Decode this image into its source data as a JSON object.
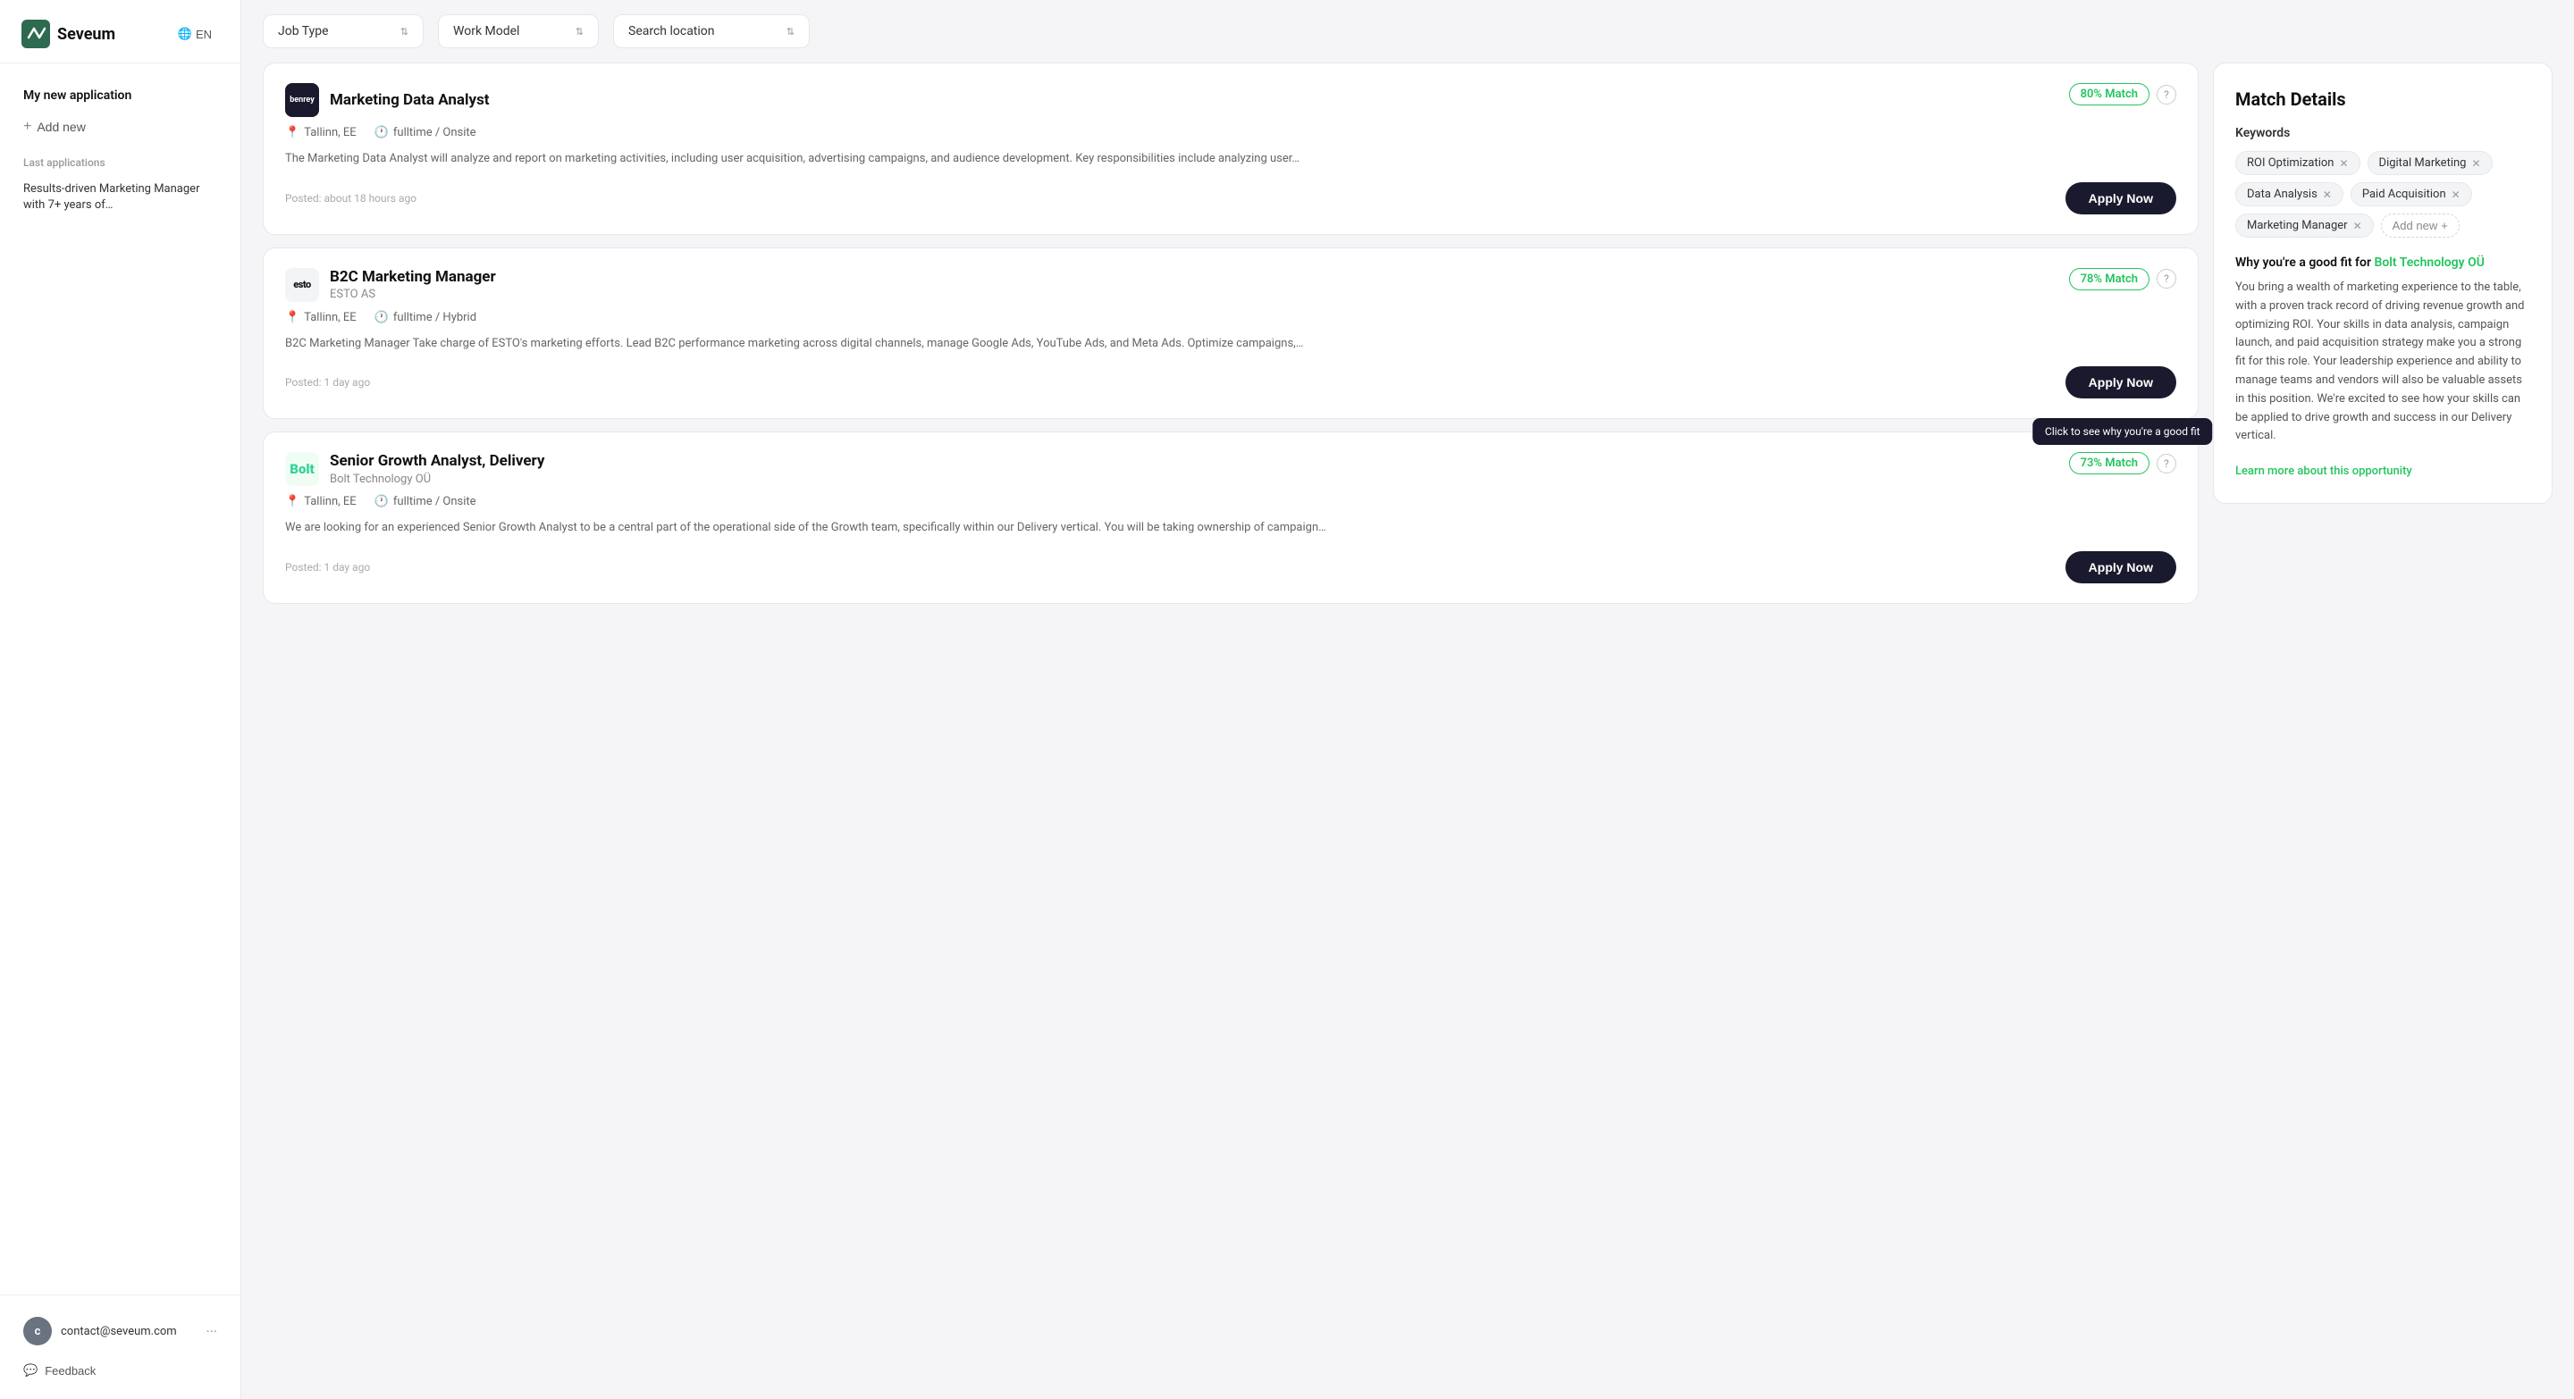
{
  "sidebar": {
    "logo_text": "Seveum",
    "lang": "EN",
    "app_title": "My new application",
    "add_new_label": "Add new",
    "last_applications_label": "Last applications",
    "last_app_preview": "Results-driven Marketing Manager with 7+ years of…",
    "user_email": "contact@seveum.com",
    "user_initial": "c",
    "feedback_label": "Feedback"
  },
  "filters": {
    "job_type_label": "Job Type",
    "work_model_label": "Work Model",
    "search_location_placeholder": "Search location"
  },
  "jobs": [
    {
      "id": "job1",
      "company": "Benrey",
      "logo_type": "benrey",
      "title": "Marketing Data Analyst",
      "location": "Tallinn, EE",
      "job_type": "fulltime / Onsite",
      "match": "80% Match",
      "description": "The Marketing Data Analyst will analyze and report on marketing activities, including user acquisition, advertising campaigns, and audience development. Key responsibilities include analyzing user…",
      "posted": "Posted: about 18 hours ago",
      "apply_label": "Apply Now"
    },
    {
      "id": "job2",
      "company": "ESTO AS",
      "logo_type": "esto",
      "title": "B2C Marketing Manager",
      "location": "Tallinn, EE",
      "job_type": "fulltime / Hybrid",
      "match": "78% Match",
      "description": "B2C Marketing Manager Take charge of ESTO's marketing efforts. Lead B2C performance marketing across digital channels, manage Google Ads, YouTube Ads, and Meta Ads. Optimize campaigns,…",
      "posted": "Posted: 1 day ago",
      "apply_label": "Apply Now"
    },
    {
      "id": "job3",
      "company": "Bolt Technology OÜ",
      "logo_type": "bolt",
      "title": "Senior Growth Analyst, Delivery",
      "location": "Tallinn, EE",
      "job_type": "fulltime / Onsite",
      "match": "73% Match",
      "description": "We are looking for an experienced Senior Growth Analyst to be a central part of the operational side of the Growth team, specifically within our Delivery vertical. You will be taking ownership of campaign…",
      "posted": "Posted: 1 day ago",
      "apply_label": "Apply Now",
      "tooltip": "Click to see why you're a good fit"
    }
  ],
  "match_details": {
    "title": "Match Details",
    "keywords_label": "Keywords",
    "keywords": [
      {
        "text": "ROI Optimization"
      },
      {
        "text": "Digital Marketing"
      },
      {
        "text": "Data Analysis"
      },
      {
        "text": "Paid Acquisition"
      },
      {
        "text": "Marketing Manager"
      }
    ],
    "add_new_label": "Add new",
    "fit_title_prefix": "Why you're a good fit for",
    "fit_company": "Bolt Technology OÜ",
    "fit_description": "You bring a wealth of marketing experience to the table, with a proven track record of driving revenue growth and optimizing ROI. Your skills in data analysis, campaign launch, and paid acquisition strategy make you a strong fit for this role. Your leadership experience and ability to manage teams and vendors will also be valuable assets in this position. We're excited to see how your skills can be applied to drive growth and success in our Delivery vertical.",
    "learn_more_label": "Learn more about this opportunity"
  }
}
